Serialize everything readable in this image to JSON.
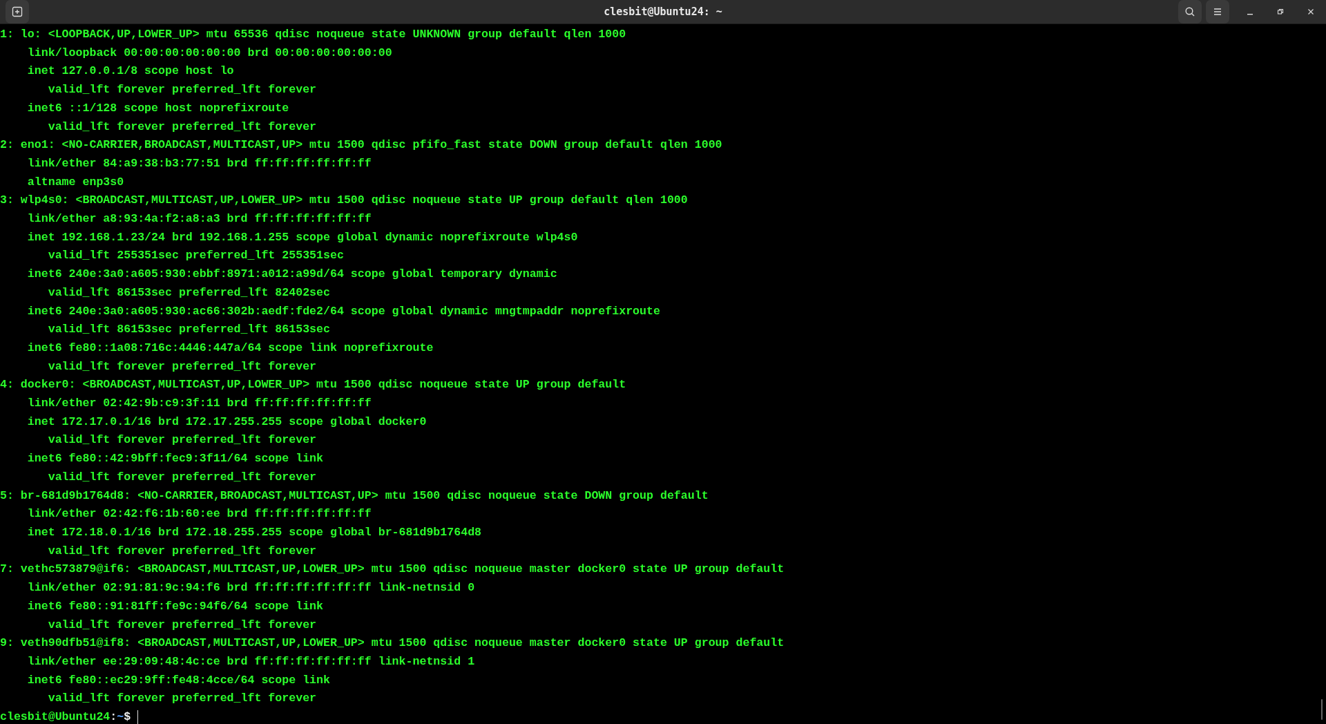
{
  "window": {
    "title": "clesbit@Ubuntu24: ~"
  },
  "terminal": {
    "lines": [
      {
        "kind": "output",
        "text": "1: lo: <LOOPBACK,UP,LOWER_UP> mtu 65536 qdisc noqueue state UNKNOWN group default qlen 1000"
      },
      {
        "kind": "output",
        "text": "    link/loopback 00:00:00:00:00:00 brd 00:00:00:00:00:00"
      },
      {
        "kind": "output",
        "text": "    inet 127.0.0.1/8 scope host lo"
      },
      {
        "kind": "output",
        "text": "       valid_lft forever preferred_lft forever"
      },
      {
        "kind": "output",
        "text": "    inet6 ::1/128 scope host noprefixroute"
      },
      {
        "kind": "output",
        "text": "       valid_lft forever preferred_lft forever"
      },
      {
        "kind": "output",
        "text": "2: eno1: <NO-CARRIER,BROADCAST,MULTICAST,UP> mtu 1500 qdisc pfifo_fast state DOWN group default qlen 1000"
      },
      {
        "kind": "output",
        "text": "    link/ether 84:a9:38:b3:77:51 brd ff:ff:ff:ff:ff:ff"
      },
      {
        "kind": "output",
        "text": "    altname enp3s0"
      },
      {
        "kind": "output",
        "text": "3: wlp4s0: <BROADCAST,MULTICAST,UP,LOWER_UP> mtu 1500 qdisc noqueue state UP group default qlen 1000"
      },
      {
        "kind": "output",
        "text": "    link/ether a8:93:4a:f2:a8:a3 brd ff:ff:ff:ff:ff:ff"
      },
      {
        "kind": "output",
        "text": "    inet 192.168.1.23/24 brd 192.168.1.255 scope global dynamic noprefixroute wlp4s0"
      },
      {
        "kind": "output",
        "text": "       valid_lft 255351sec preferred_lft 255351sec"
      },
      {
        "kind": "output",
        "text": "    inet6 240e:3a0:a605:930:ebbf:8971:a012:a99d/64 scope global temporary dynamic"
      },
      {
        "kind": "output",
        "text": "       valid_lft 86153sec preferred_lft 82402sec"
      },
      {
        "kind": "output",
        "text": "    inet6 240e:3a0:a605:930:ac66:302b:aedf:fde2/64 scope global dynamic mngtmpaddr noprefixroute"
      },
      {
        "kind": "output",
        "text": "       valid_lft 86153sec preferred_lft 86153sec"
      },
      {
        "kind": "output",
        "text": "    inet6 fe80::1a08:716c:4446:447a/64 scope link noprefixroute"
      },
      {
        "kind": "output",
        "text": "       valid_lft forever preferred_lft forever"
      },
      {
        "kind": "output",
        "text": "4: docker0: <BROADCAST,MULTICAST,UP,LOWER_UP> mtu 1500 qdisc noqueue state UP group default"
      },
      {
        "kind": "output",
        "text": "    link/ether 02:42:9b:c9:3f:11 brd ff:ff:ff:ff:ff:ff"
      },
      {
        "kind": "output",
        "text": "    inet 172.17.0.1/16 brd 172.17.255.255 scope global docker0"
      },
      {
        "kind": "output",
        "text": "       valid_lft forever preferred_lft forever"
      },
      {
        "kind": "output",
        "text": "    inet6 fe80::42:9bff:fec9:3f11/64 scope link"
      },
      {
        "kind": "output",
        "text": "       valid_lft forever preferred_lft forever"
      },
      {
        "kind": "output",
        "text": "5: br-681d9b1764d8: <NO-CARRIER,BROADCAST,MULTICAST,UP> mtu 1500 qdisc noqueue state DOWN group default"
      },
      {
        "kind": "output",
        "text": "    link/ether 02:42:f6:1b:60:ee brd ff:ff:ff:ff:ff:ff"
      },
      {
        "kind": "output",
        "text": "    inet 172.18.0.1/16 brd 172.18.255.255 scope global br-681d9b1764d8"
      },
      {
        "kind": "output",
        "text": "       valid_lft forever preferred_lft forever"
      },
      {
        "kind": "output",
        "text": "7: vethc573879@if6: <BROADCAST,MULTICAST,UP,LOWER_UP> mtu 1500 qdisc noqueue master docker0 state UP group default"
      },
      {
        "kind": "output",
        "text": "    link/ether 02:91:81:9c:94:f6 brd ff:ff:ff:ff:ff:ff link-netnsid 0"
      },
      {
        "kind": "output",
        "text": "    inet6 fe80::91:81ff:fe9c:94f6/64 scope link"
      },
      {
        "kind": "output",
        "text": "       valid_lft forever preferred_lft forever"
      },
      {
        "kind": "output",
        "text": "9: veth90dfb51@if8: <BROADCAST,MULTICAST,UP,LOWER_UP> mtu 1500 qdisc noqueue master docker0 state UP group default"
      },
      {
        "kind": "output",
        "text": "    link/ether ee:29:09:48:4c:ce brd ff:ff:ff:ff:ff:ff link-netnsid 1"
      },
      {
        "kind": "output",
        "text": "    inet6 fe80::ec29:9ff:fe48:4cce/64 scope link"
      },
      {
        "kind": "output",
        "text": "       valid_lft forever preferred_lft forever"
      },
      {
        "kind": "prompt",
        "user_host": "clesbit@Ubuntu24",
        "separator": ":",
        "path": "~",
        "symbol": "$"
      }
    ]
  }
}
